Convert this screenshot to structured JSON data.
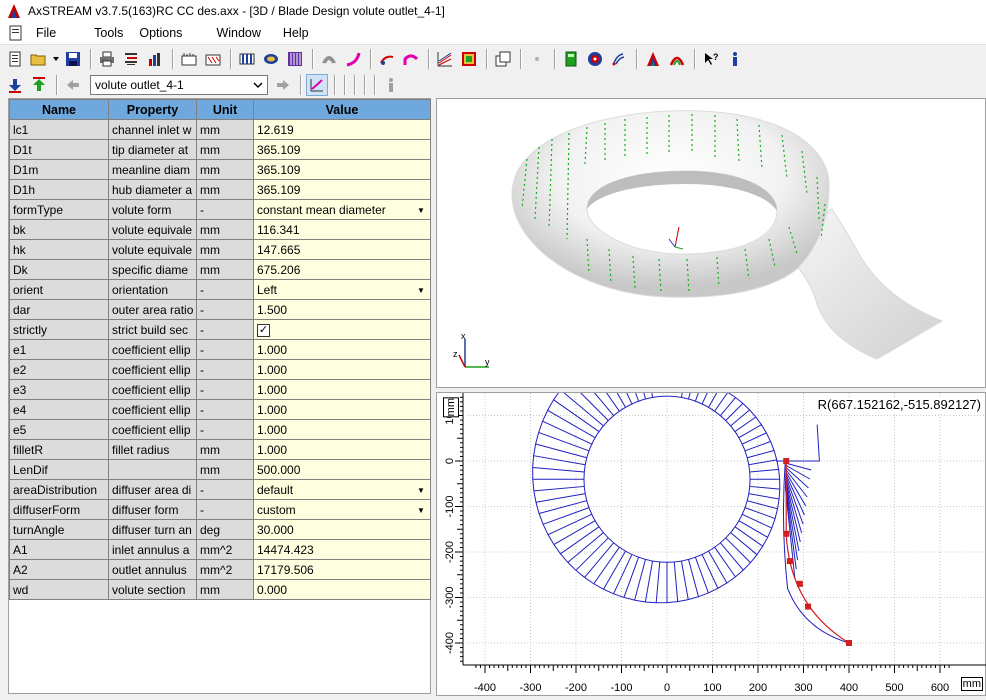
{
  "window": {
    "title": "AxSTREAM  v3.7.5(163)RC    CC des.axx - [3D / Blade Design   volute outlet_4-1]"
  },
  "menu": [
    "File",
    "Tools",
    "Options",
    "Window",
    "Help"
  ],
  "toolbar": {
    "object_selector": "volute outlet_4-1"
  },
  "table": {
    "headers": [
      "Name",
      "Property",
      "Unit",
      "Value"
    ],
    "rows": [
      {
        "name": "lc1",
        "property": "channel inlet w",
        "unit": "mm",
        "value": "12.619"
      },
      {
        "name": "D1t",
        "property": "tip diameter at",
        "unit": "mm",
        "value": "365.109"
      },
      {
        "name": "D1m",
        "property": "meanline diam",
        "unit": "mm",
        "value": "365.109"
      },
      {
        "name": "D1h",
        "property": "hub diameter a",
        "unit": "mm",
        "value": "365.109"
      },
      {
        "name": "formType",
        "property": "volute form",
        "unit": "-",
        "value": "constant mean diameter",
        "dropdown": true
      },
      {
        "name": "bk",
        "property": "volute equivale",
        "unit": "mm",
        "value": "116.341"
      },
      {
        "name": "hk",
        "property": "volute equivale",
        "unit": "mm",
        "value": "147.665"
      },
      {
        "name": "Dk",
        "property": "specific diame",
        "unit": "mm",
        "value": "675.206"
      },
      {
        "name": "orient",
        "property": "orientation",
        "unit": "-",
        "value": "Left",
        "dropdown": true
      },
      {
        "name": "dar",
        "property": "outer area ratio",
        "unit": "-",
        "value": "1.500"
      },
      {
        "name": "strictly",
        "property": "strict build sec",
        "unit": "-",
        "value": "",
        "checkbox": true
      },
      {
        "name": "e1",
        "property": "coefficient ellip",
        "unit": "-",
        "value": "1.000"
      },
      {
        "name": "e2",
        "property": "coefficient ellip",
        "unit": "-",
        "value": "1.000"
      },
      {
        "name": "e3",
        "property": "coefficient ellip",
        "unit": "-",
        "value": "1.000"
      },
      {
        "name": "e4",
        "property": "coefficient ellip",
        "unit": "-",
        "value": "1.000"
      },
      {
        "name": "e5",
        "property": "coefficient ellip",
        "unit": "-",
        "value": "1.000"
      },
      {
        "name": "filletR",
        "property": "fillet radius",
        "unit": "mm",
        "value": "1.000"
      },
      {
        "name": "LenDif",
        "property": "",
        "unit": "mm",
        "value": "500.000"
      },
      {
        "name": "areaDistribution",
        "property": "diffuser area di",
        "unit": "-",
        "value": "default",
        "dropdown": true
      },
      {
        "name": "diffuserForm",
        "property": "diffuser form",
        "unit": "-",
        "value": "custom",
        "dropdown": true
      },
      {
        "name": "turnAngle",
        "property": "diffuser turn an",
        "unit": "deg",
        "value": "30.000"
      },
      {
        "name": "A1",
        "property": "inlet annulus a",
        "unit": "mm^2",
        "value": "14474.423"
      },
      {
        "name": "A2",
        "property": "outlet annulus",
        "unit": "mm^2",
        "value": "17179.506"
      },
      {
        "name": "wd",
        "property": "volute section",
        "unit": "mm",
        "value": "0.000"
      }
    ]
  },
  "view3d": {
    "axes": {
      "x": "x",
      "y": "y",
      "z": "z"
    }
  },
  "view2d": {
    "cursor_readout": "R(667.152162,-515.892127)",
    "x_ticks": [
      "-400",
      "-300",
      "-200",
      "-100",
      "0",
      "100",
      "200",
      "300",
      "400",
      "500",
      "600"
    ],
    "y_ticks": [
      "100",
      "0",
      "-100",
      "-200",
      "-300",
      "-400"
    ],
    "unit": "mm"
  },
  "colors": {
    "header_blue": "#6fa8dc",
    "value_bg": "#ffffe0",
    "grid_line": "#c0c0c0",
    "contour_blue": "#2020c0",
    "curve_red": "#d02020"
  }
}
